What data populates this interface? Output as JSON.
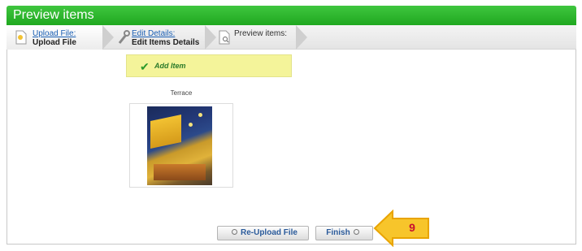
{
  "window": {
    "title": "Preview items"
  },
  "steps": [
    {
      "link": "Upload File:",
      "current": "Upload File"
    },
    {
      "link": "Edit Details:",
      "current": "Edit Items Details"
    },
    {
      "label": "Preview items:"
    }
  ],
  "add_item": {
    "label": "Add Item"
  },
  "item": {
    "name": "Terrace"
  },
  "buttons": {
    "reupload": "Re-Upload File",
    "finish": "Finish"
  },
  "callout": {
    "number": "9"
  },
  "colors": {
    "title_bar": "#1fa81f",
    "highlight": "#f4f49a",
    "callout": "#f7c52b"
  }
}
